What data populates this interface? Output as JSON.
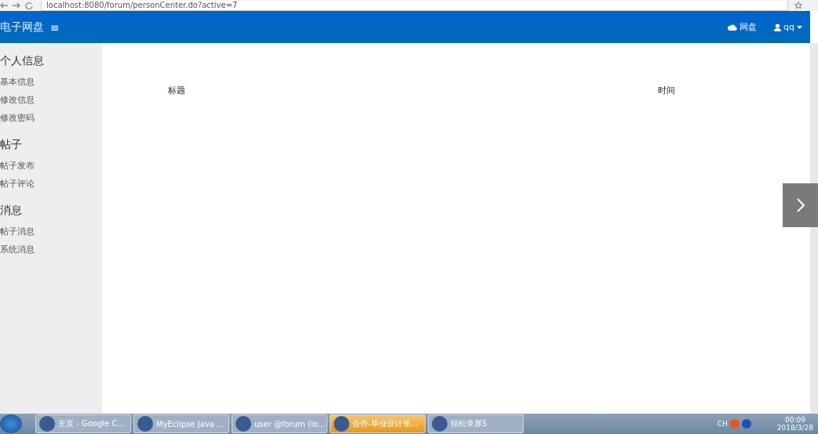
{
  "browser": {
    "url": "localhost:8080/forum/personCenter.do?active=7"
  },
  "navbar": {
    "brand": "电子网盘",
    "menu_icon": "≡",
    "links": [
      {
        "label": "网盘"
      },
      {
        "label": "qq"
      }
    ]
  },
  "sidebar": {
    "groups": [
      {
        "title": "个人信息",
        "items": [
          "基本信息",
          "修改信息",
          "修改密码"
        ]
      },
      {
        "title": "帖子",
        "items": [
          "帖子发布",
          "帖子评论"
        ]
      },
      {
        "title": "消息",
        "items": [
          "帖子消息",
          "系统消息"
        ]
      }
    ]
  },
  "table": {
    "columns": [
      "标题",
      "时间"
    ]
  },
  "taskbar": {
    "items": [
      {
        "label": "主页 - Google C...",
        "selected": false
      },
      {
        "label": "MyEclipse Java ...",
        "selected": false
      },
      {
        "label": "user @forum (lo...",
        "selected": false
      },
      {
        "label": "合作-毕业设计等...",
        "selected": true
      },
      {
        "label": "轻松录屏5",
        "selected": false
      }
    ],
    "tray": {
      "lang": "CH",
      "time": "00:09",
      "date": "2018/3/28"
    }
  }
}
